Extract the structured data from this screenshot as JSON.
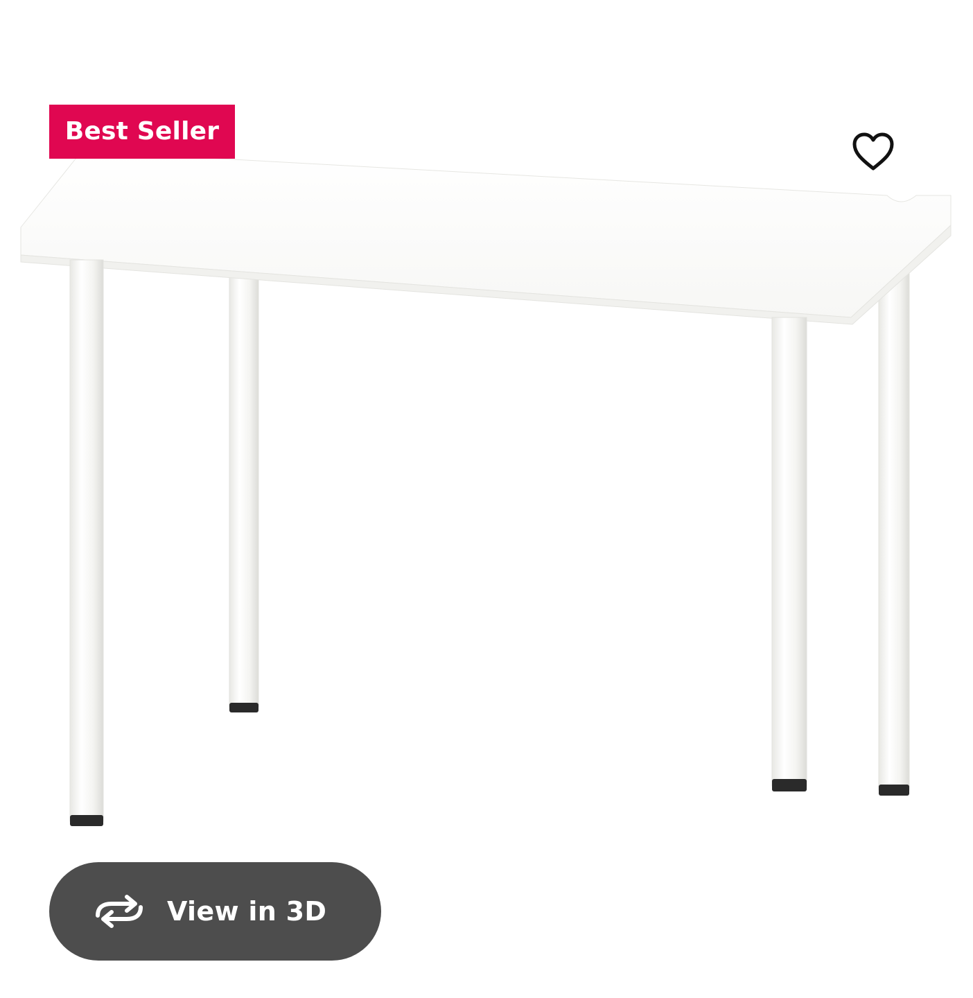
{
  "product": {
    "badge_label": "Best Seller",
    "image_icon": "desk-product-image",
    "favorite_icon": "heart-icon",
    "view_3d_label": "View in 3D",
    "view_3d_icon": "rotate-icon"
  },
  "colors": {
    "badge_background": "#e00751",
    "view_3d_background": "#4d4d4d",
    "foreground_text": "#ffffff",
    "icon_stroke": "#111111"
  }
}
